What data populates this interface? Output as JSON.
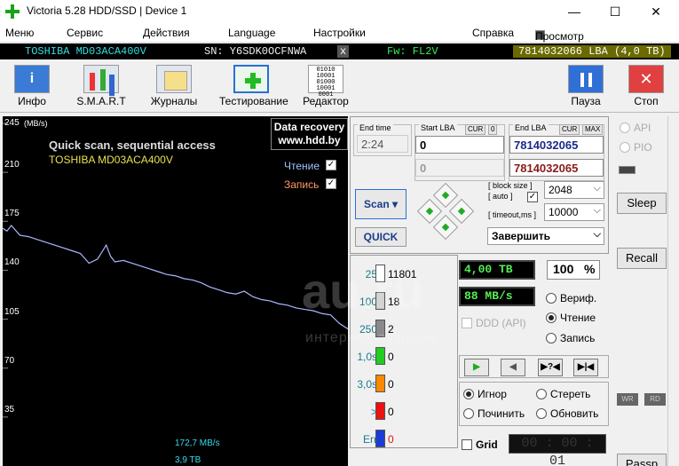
{
  "window": {
    "title": "Victoria 5.28 HDD/SSD | Device 1",
    "min": "—",
    "max": "☐",
    "close": "✕"
  },
  "menu": [
    "Меню",
    "Сервис",
    "Действия",
    "Language",
    "Настройки",
    "Справка"
  ],
  "menu_buffer": "Просмотр буфера",
  "device": {
    "model": "TOSHIBA MD03ACA400V",
    "sn": "SN: Y6SDK0OCFNWA",
    "x": "x",
    "fw": "Fw: FL2V",
    "lba": "7814032066 LBA (4,0 TB)"
  },
  "toolbar": {
    "info": "Инфо",
    "smart": "S.M.A.R.T",
    "logs": "Журналы",
    "testing": "Тестирование",
    "editor": "Редактор",
    "pause": "Пауза",
    "stop": "Стоп",
    "info_icon": "i",
    "editor_icon": "01010\n10001\n01000\n10001\n0001",
    "stop_icon": "✕"
  },
  "graph": {
    "unit": "(MB/s)",
    "ticks": [
      "245",
      "210",
      "175",
      "140",
      "105",
      "70",
      "35"
    ],
    "title": "Quick scan, sequential access",
    "model": "TOSHIBA MD03ACA400V",
    "promo1": "Data recovery",
    "promo2": "www.hdd.by",
    "read_label": "Чтение",
    "write_label": "Запись",
    "check": "✓",
    "speed": "172,7 MB/s",
    "position": "3,9 TB"
  },
  "chart_data": {
    "type": "line",
    "title": "Quick scan, sequential access",
    "ylabel": "(MB/s)",
    "ylim": [
      0,
      245
    ],
    "yticks": [
      245,
      210,
      175,
      140,
      105,
      70,
      35
    ],
    "xlim": [
      0,
      4.0
    ],
    "series": [
      {
        "name": "Чтение",
        "color": "#a9b8ff",
        "x": [
          0,
          0.05,
          0.1,
          0.2,
          0.3,
          0.4,
          0.5,
          0.6,
          0.7,
          0.8,
          0.9,
          1.0,
          1.1,
          1.2,
          1.25,
          1.3,
          1.4,
          1.5,
          1.6,
          1.7,
          1.8,
          1.9,
          2.0,
          2.1,
          2.2,
          2.3,
          2.4,
          2.5,
          2.6,
          2.7,
          2.8,
          2.9,
          3.0,
          3.1,
          3.2,
          3.3,
          3.4,
          3.5,
          3.6,
          3.7,
          3.8,
          3.9,
          4.0
        ],
        "values": [
          170,
          168,
          172,
          165,
          164,
          162,
          160,
          158,
          156,
          154,
          152,
          145,
          148,
          158,
          150,
          146,
          147,
          145,
          143,
          141,
          139,
          137,
          136,
          134,
          133,
          131,
          128,
          126,
          124,
          123,
          125,
          121,
          119,
          118,
          116,
          115,
          113,
          112,
          111,
          109,
          108,
          102,
          98
        ]
      }
    ]
  },
  "scan": {
    "end_time_label": "End time",
    "end_time": "2:24",
    "start_lba_label": "Start LBA",
    "cur": "CUR",
    "zero": "0",
    "start_lba": "0",
    "start_lba2": "0",
    "end_lba_label": "End LBA",
    "max": "MAX",
    "end_lba": "7814032065",
    "end_lba2": "7814032065",
    "scan_btn": "Scan",
    "scan_arrow": "▾",
    "quick_btn": "QUICK",
    "block_size_label": "block size",
    "auto_label": "auto",
    "timeout_label": "timeout,ms",
    "block_size": "2048",
    "timeout": "10000",
    "finish": "Завершить",
    "arrow": "⌵"
  },
  "stats": [
    {
      "label": "25",
      "value": "11801",
      "color": "#ffffff"
    },
    {
      "label": "100",
      "value": "18",
      "color": "#c8c8c8"
    },
    {
      "label": "250",
      "value": "2",
      "color": "#8a8a8a"
    },
    {
      "label": "1,0s",
      "value": "0",
      "color": "#22cc22"
    },
    {
      "label": "3,0s",
      "value": "0",
      "color": "#ff8800"
    },
    {
      "label": ">",
      "value": "0",
      "color": "#ee1111"
    },
    {
      "label": "Err",
      "value": "0",
      "color": "#1a3cd6"
    }
  ],
  "progress": {
    "done": "4,00 TB",
    "percent": "100",
    "pct_sign": "%",
    "speed": "88 MB/s",
    "ddd": "DDD (API)",
    "verify": "Вериф.",
    "read": "Чтение",
    "write": "Запись",
    "ignore": "Игнор",
    "erase": "Стереть",
    "repair": "Починить",
    "refresh": "Обновить",
    "grid": "Grid",
    "timer": "00 : 00 : 01",
    "play_icon": "▶",
    "back_icon": "◀",
    "qmark_icon": "▶?◀",
    "end_icon": "▶|◀"
  },
  "right": {
    "api": "API",
    "pio": "PIO",
    "sleep": "Sleep",
    "recall": "Recall",
    "wr": "WR",
    "rd": "RD",
    "passp": "Passp"
  },
  "watermark": {
    "big": "au.ru",
    "small": "интернет-аукцион"
  }
}
